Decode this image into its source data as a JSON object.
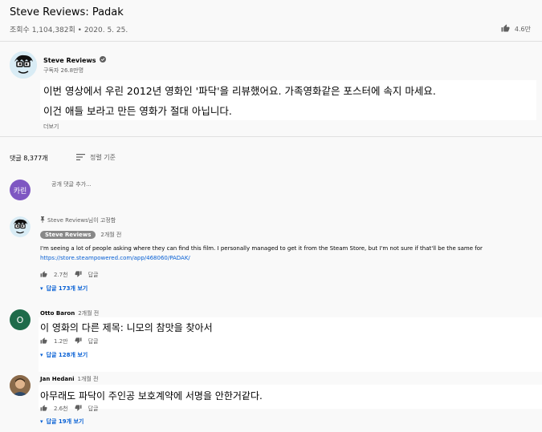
{
  "video": {
    "title": "Steve Reviews: Padak",
    "meta": "조회수 1,104,382회 • 2020. 5. 25.",
    "likes": "4.6만"
  },
  "channel": {
    "name": "Steve Reviews",
    "subs": "구독자 26.8만명",
    "description_line1": "이번 영상에서 우린 2012년 영화인 '파닥'을 리뷰했어요. 가족영화같은 포스터에 속지 마세요.",
    "description_line2": "이건 애들 보라고 만든 영화가 절대 아닙니다.",
    "more": "더보기"
  },
  "comments_header": {
    "count": "댓글 8,377개",
    "sort_label": "정렬 기준"
  },
  "add_comment": {
    "avatar_text": "카린",
    "placeholder": "공개 댓글 추가..."
  },
  "comments": [
    {
      "pinned": "Steve Reviews님이 고정함",
      "author": "Steve Reviews",
      "time": "2개월 전",
      "text": "I'm seeing a lot of people asking where they can find this film. I personally managed to get it from the Steam Store, but I'm not sure if that'll be the same for",
      "link": "https://store.steampowered.com/app/468060/PADAK/",
      "likes": "2.7천",
      "reply_label": "답글",
      "replies": "답글 173개 보기"
    },
    {
      "avatar_letter": "O",
      "author": "Otto Baron",
      "time": "2개월 전",
      "text": "이 영화의 다른 제목: 니모의 참맛을 찾아서",
      "likes": "1.2만",
      "reply_label": "답글",
      "replies": "답글 128개 보기"
    },
    {
      "author": "Jan Hedani",
      "time": "1개월 전",
      "text": "아무래도 파닥이 주인공 보호계약에 서명을 안한거같다.",
      "likes": "2.6천",
      "reply_label": "답글",
      "replies": "답글 19개 보기"
    }
  ],
  "colors": {
    "accent_blue": "#065fd4",
    "add_avatar": "#7e57c2",
    "otto_avatar": "#1e6b4a"
  }
}
